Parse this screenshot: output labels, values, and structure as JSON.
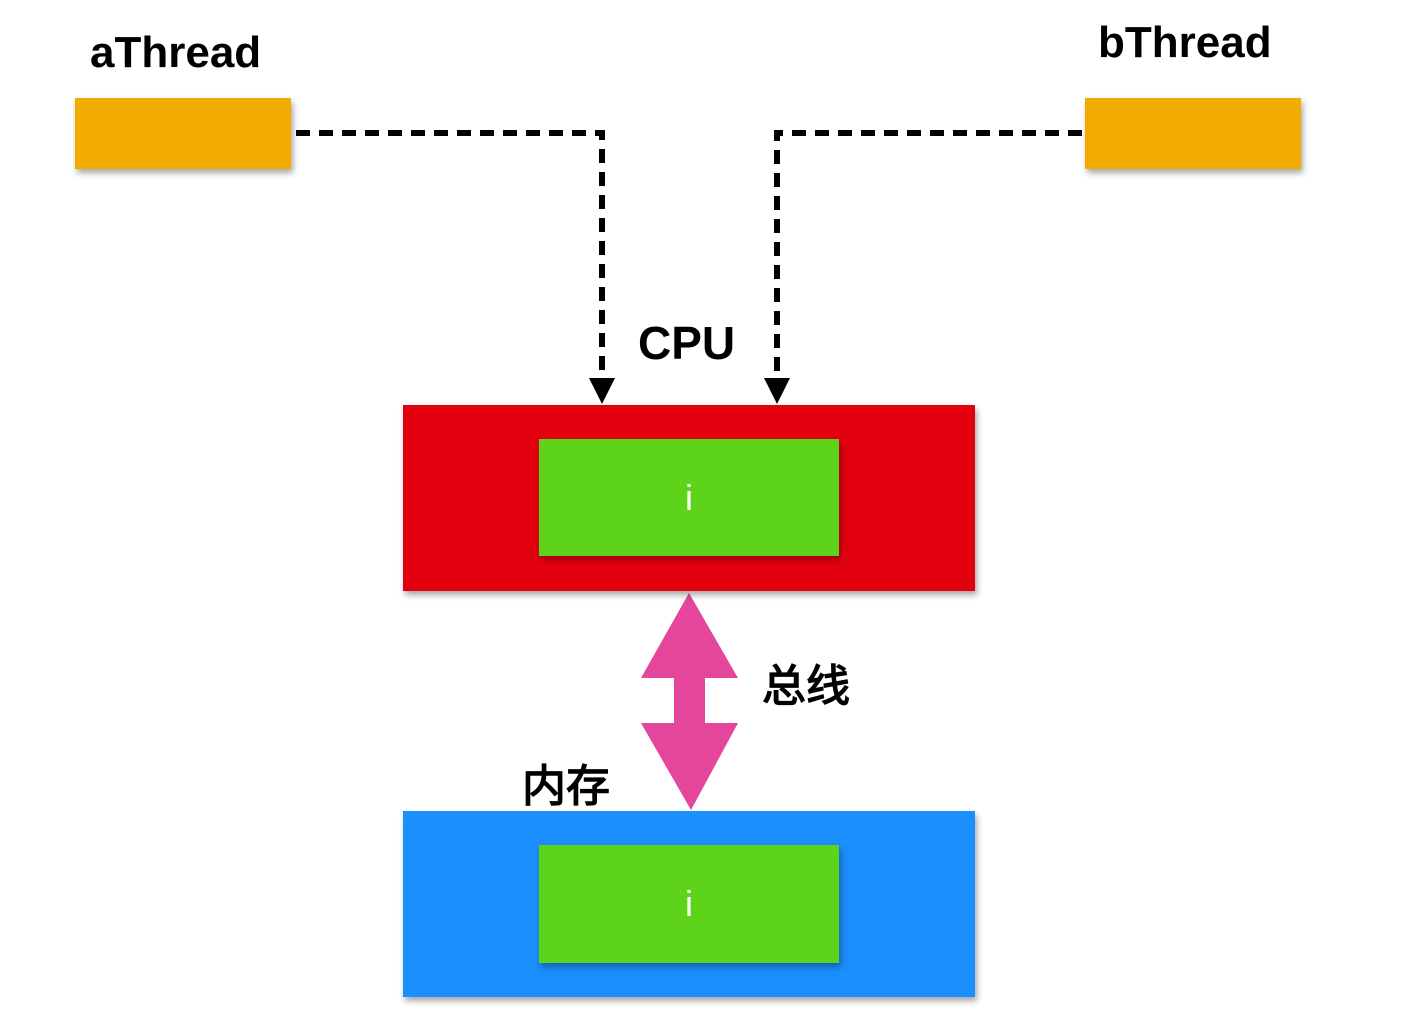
{
  "colors": {
    "thread": "#f2ac00",
    "cpu": "#e2000f",
    "memory": "#1b8ffd",
    "variable": "#5dd41a",
    "bus": "#e3469a",
    "connector": "#000000"
  },
  "threads": [
    {
      "label": "aThread"
    },
    {
      "label": "bThread"
    }
  ],
  "cpu": {
    "label": "CPU",
    "variable": "i"
  },
  "bus": {
    "label": "总线"
  },
  "memory": {
    "label": "内存",
    "variable": "i"
  }
}
